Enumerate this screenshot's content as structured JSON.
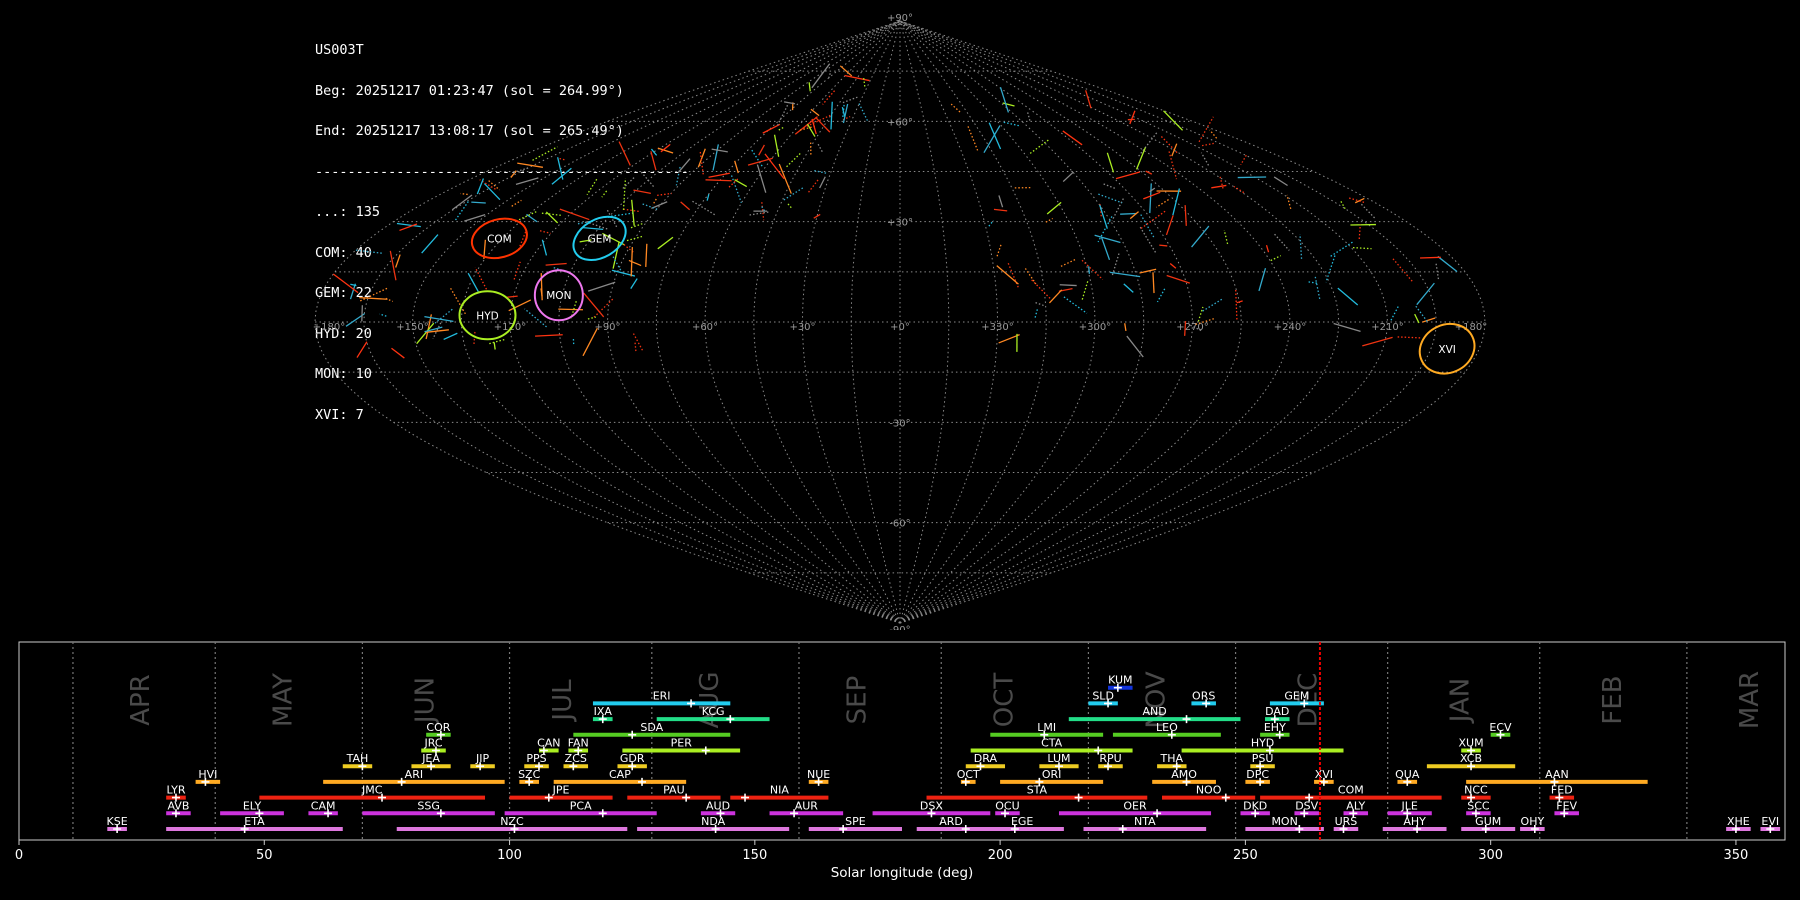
{
  "info": {
    "station": "US003T",
    "begin": "Beg: 20251217 01:23:47 (sol = 264.99°)",
    "end": "End: 20251217 13:08:17 (sol = 265.49°)",
    "separator": "----------------------------------------------",
    "counts": [
      "...: 135",
      "COM: 40",
      "GEM: 22",
      "HYD: 20",
      "MON: 10",
      "XVI: 7"
    ]
  },
  "chart_data": [
    {
      "type": "scatter",
      "projection": "sinusoidal",
      "background": "#000000",
      "grid": true,
      "lon_tick_labels": [
        "+180°",
        "+150°",
        "+120°",
        "+90°",
        "+60°",
        "+30°",
        "+0°",
        "+330°",
        "+300°",
        "+270°",
        "+240°",
        "+210°",
        "+180°"
      ],
      "lon_ticks": [
        180,
        150,
        120,
        90,
        60,
        30,
        0,
        -30,
        -60,
        -90,
        -120,
        -150,
        -180
      ],
      "lat_tick_labels": [
        "+90°",
        "+60°",
        "+30°",
        "-30°",
        "-60°",
        "-90°"
      ],
      "lat_ticks": [
        90,
        60,
        30,
        -30,
        -60,
        -90
      ],
      "radiants": [
        {
          "name": "COM",
          "lon": 136,
          "lat": 25,
          "color": "#ff3300"
        },
        {
          "name": "GEM",
          "lon": 102,
          "lat": 25,
          "color": "#22ccee"
        },
        {
          "name": "MON",
          "lon": 106,
          "lat": 8,
          "color": "#ee77ee"
        },
        {
          "name": "HYD",
          "lon": 127,
          "lat": 2,
          "color": "#aaee22"
        },
        {
          "name": "XVI",
          "lon": -170,
          "lat": -8,
          "color": "#ffaa22"
        }
      ]
    },
    {
      "type": "bar",
      "orientation": "horizontal-timeline",
      "xlabel": "Solar longitude (deg)",
      "xlim": [
        0,
        360
      ],
      "x_ticks": [
        0,
        50,
        100,
        150,
        200,
        250,
        300,
        350
      ],
      "current_sol": 265.2,
      "month_boundaries": [
        11,
        40,
        70,
        100,
        129,
        159,
        188,
        218,
        248,
        279,
        310,
        340
      ],
      "months": [
        {
          "label": "APR",
          "sol": 25
        },
        {
          "label": "MAY",
          "sol": 54
        },
        {
          "label": "JUN",
          "sol": 83
        },
        {
          "label": "JUL",
          "sol": 111
        },
        {
          "label": "AUG",
          "sol": 141
        },
        {
          "label": "SEP",
          "sol": 171
        },
        {
          "label": "OCT",
          "sol": 201
        },
        {
          "label": "NOV",
          "sol": 232
        },
        {
          "label": "DEC",
          "sol": 263
        },
        {
          "label": "JAN",
          "sol": 294
        },
        {
          "label": "FEB",
          "sol": 325
        },
        {
          "label": "MAR",
          "sol": 353
        }
      ],
      "showers": [
        {
          "name": "KUM",
          "start": 222,
          "end": 227,
          "peak": 224,
          "row": 9,
          "color": "#1133dd"
        },
        {
          "name": "ERI",
          "start": 117,
          "end": 145,
          "peak": 137,
          "row": 8,
          "color": "#22ccee"
        },
        {
          "name": "SLD",
          "start": 218,
          "end": 224,
          "peak": 222,
          "row": 8,
          "color": "#22ccee"
        },
        {
          "name": "ORS",
          "start": 239,
          "end": 244,
          "peak": 242,
          "row": 8,
          "color": "#22ccee"
        },
        {
          "name": "GEM",
          "start": 255,
          "end": 266,
          "peak": 262,
          "row": 8,
          "color": "#22ccee"
        },
        {
          "name": "IXA",
          "start": 117,
          "end": 121,
          "peak": 119,
          "row": 7,
          "color": "#22dd88"
        },
        {
          "name": "KCG",
          "start": 130,
          "end": 153,
          "peak": 145,
          "row": 7,
          "color": "#22dd88"
        },
        {
          "name": "AND",
          "start": 214,
          "end": 249,
          "peak": 238,
          "row": 7,
          "color": "#22dd88"
        },
        {
          "name": "DAD",
          "start": 254,
          "end": 259,
          "peak": 256,
          "row": 7,
          "color": "#22dd88"
        },
        {
          "name": "COR",
          "start": 83,
          "end": 88,
          "peak": 86,
          "row": 6,
          "color": "#55cc22"
        },
        {
          "name": "SDA",
          "start": 113,
          "end": 145,
          "peak": 125,
          "row": 6,
          "color": "#55cc22"
        },
        {
          "name": "LMI",
          "start": 198,
          "end": 221,
          "peak": 209,
          "row": 6,
          "color": "#55cc22"
        },
        {
          "name": "LEO",
          "start": 223,
          "end": 245,
          "peak": 235,
          "row": 6,
          "color": "#55cc22"
        },
        {
          "name": "EHY",
          "start": 253,
          "end": 259,
          "peak": 257,
          "row": 6,
          "color": "#55cc22"
        },
        {
          "name": "ECV",
          "start": 300,
          "end": 304,
          "peak": 302,
          "row": 6,
          "color": "#55cc22"
        },
        {
          "name": "JRC",
          "start": 82,
          "end": 87,
          "peak": 85,
          "row": 5,
          "color": "#aaee22"
        },
        {
          "name": "CAN",
          "start": 106,
          "end": 110,
          "peak": 107,
          "row": 5,
          "color": "#aaee22"
        },
        {
          "name": "FAN",
          "start": 112,
          "end": 116,
          "peak": 114,
          "row": 5,
          "color": "#aaee22"
        },
        {
          "name": "PER",
          "start": 123,
          "end": 147,
          "peak": 140,
          "row": 5,
          "color": "#aaee22"
        },
        {
          "name": "CTA",
          "start": 194,
          "end": 227,
          "peak": 220,
          "row": 5,
          "color": "#aaee22"
        },
        {
          "name": "HYD",
          "start": 237,
          "end": 270,
          "peak": 255,
          "row": 5,
          "color": "#aaee22"
        },
        {
          "name": "XUM",
          "start": 294,
          "end": 298,
          "peak": 296,
          "row": 5,
          "color": "#aaee22"
        },
        {
          "name": "TAH",
          "start": 66,
          "end": 72,
          "peak": 70,
          "row": 4,
          "color": "#eecc22"
        },
        {
          "name": "JEA",
          "start": 80,
          "end": 88,
          "peak": 84,
          "row": 4,
          "color": "#eecc22"
        },
        {
          "name": "JIP",
          "start": 92,
          "end": 97,
          "peak": 94,
          "row": 4,
          "color": "#eecc22"
        },
        {
          "name": "PPS",
          "start": 103,
          "end": 108,
          "peak": 106,
          "row": 4,
          "color": "#eecc22"
        },
        {
          "name": "ZCS",
          "start": 111,
          "end": 116,
          "peak": 113,
          "row": 4,
          "color": "#eecc22"
        },
        {
          "name": "GDR",
          "start": 122,
          "end": 128,
          "peak": 125,
          "row": 4,
          "color": "#eecc22"
        },
        {
          "name": "DRA",
          "start": 193,
          "end": 201,
          "peak": 196,
          "row": 4,
          "color": "#eecc22"
        },
        {
          "name": "LUM",
          "start": 208,
          "end": 216,
          "peak": 212,
          "row": 4,
          "color": "#eecc22"
        },
        {
          "name": "RPU",
          "start": 220,
          "end": 225,
          "peak": 222,
          "row": 4,
          "color": "#eecc22"
        },
        {
          "name": "THA",
          "start": 232,
          "end": 238,
          "peak": 236,
          "row": 4,
          "color": "#eecc22"
        },
        {
          "name": "PSU",
          "start": 251,
          "end": 256,
          "peak": 253,
          "row": 4,
          "color": "#eecc22"
        },
        {
          "name": "XCB",
          "start": 287,
          "end": 305,
          "peak": 296,
          "row": 4,
          "color": "#eecc22"
        },
        {
          "name": "HVI",
          "start": 36,
          "end": 41,
          "peak": 38,
          "row": 3,
          "color": "#ffaa22"
        },
        {
          "name": "ARI",
          "start": 62,
          "end": 99,
          "peak": 78,
          "row": 3,
          "color": "#ffaa22"
        },
        {
          "name": "SZC",
          "start": 102,
          "end": 106,
          "peak": 104,
          "row": 3,
          "color": "#ffaa22"
        },
        {
          "name": "CAP",
          "start": 109,
          "end": 136,
          "peak": 127,
          "row": 3,
          "color": "#ffaa22"
        },
        {
          "name": "NUE",
          "start": 161,
          "end": 165,
          "peak": 163,
          "row": 3,
          "color": "#ffaa22"
        },
        {
          "name": "OCT",
          "start": 192,
          "end": 195,
          "peak": 193,
          "row": 3,
          "color": "#ffaa22"
        },
        {
          "name": "ORI",
          "start": 200,
          "end": 221,
          "peak": 208,
          "row": 3,
          "color": "#ffaa22"
        },
        {
          "name": "AMO",
          "start": 231,
          "end": 244,
          "peak": 238,
          "row": 3,
          "color": "#ffaa22"
        },
        {
          "name": "DPC",
          "start": 250,
          "end": 255,
          "peak": 253,
          "row": 3,
          "color": "#ffaa22"
        },
        {
          "name": "XVI",
          "start": 264,
          "end": 268,
          "peak": 266,
          "row": 3,
          "color": "#ffaa22"
        },
        {
          "name": "QUA",
          "start": 281,
          "end": 285,
          "peak": 283,
          "row": 3,
          "color": "#ffaa22"
        },
        {
          "name": "AAN",
          "start": 295,
          "end": 332,
          "peak": 313,
          "row": 3,
          "color": "#ffaa22"
        },
        {
          "name": "LYR",
          "start": 30,
          "end": 34,
          "peak": 32,
          "row": 2,
          "color": "#ee2211"
        },
        {
          "name": "JMC",
          "start": 49,
          "end": 95,
          "peak": 74,
          "row": 2,
          "color": "#ee2211"
        },
        {
          "name": "JPE",
          "start": 100,
          "end": 121,
          "peak": 108,
          "row": 2,
          "color": "#ee2211"
        },
        {
          "name": "PAU",
          "start": 124,
          "end": 143,
          "peak": 136,
          "row": 2,
          "color": "#ee2211"
        },
        {
          "name": "NIA",
          "start": 145,
          "end": 165,
          "peak": 148,
          "row": 2,
          "color": "#ee2211"
        },
        {
          "name": "STA",
          "start": 185,
          "end": 230,
          "peak": 216,
          "row": 2,
          "color": "#ee2211"
        },
        {
          "name": "NOO",
          "start": 233,
          "end": 252,
          "peak": 246,
          "row": 2,
          "color": "#ee2211"
        },
        {
          "name": "COM",
          "start": 253,
          "end": 290,
          "peak": 263,
          "row": 2,
          "color": "#ee2211"
        },
        {
          "name": "NCC",
          "start": 294,
          "end": 300,
          "peak": 296,
          "row": 2,
          "color": "#ee2211"
        },
        {
          "name": "FED",
          "start": 312,
          "end": 317,
          "peak": 314,
          "row": 2,
          "color": "#ee2211"
        },
        {
          "name": "AVB",
          "start": 30,
          "end": 35,
          "peak": 32,
          "row": 1,
          "color": "#cc33dd"
        },
        {
          "name": "ELY",
          "start": 41,
          "end": 54,
          "peak": 49,
          "row": 1,
          "color": "#cc33dd"
        },
        {
          "name": "CAM",
          "start": 59,
          "end": 65,
          "peak": 63,
          "row": 1,
          "color": "#cc33dd"
        },
        {
          "name": "SSG",
          "start": 70,
          "end": 97,
          "peak": 86,
          "row": 1,
          "color": "#cc33dd"
        },
        {
          "name": "PCA",
          "start": 99,
          "end": 130,
          "peak": 119,
          "row": 1,
          "color": "#cc33dd"
        },
        {
          "name": "AUD",
          "start": 139,
          "end": 146,
          "peak": 143,
          "row": 1,
          "color": "#cc33dd"
        },
        {
          "name": "AUR",
          "start": 153,
          "end": 168,
          "peak": 158,
          "row": 1,
          "color": "#cc33dd"
        },
        {
          "name": "DSX",
          "start": 174,
          "end": 198,
          "peak": 186,
          "row": 1,
          "color": "#cc33dd"
        },
        {
          "name": "OCU",
          "start": 199,
          "end": 204,
          "peak": 201,
          "row": 1,
          "color": "#cc33dd"
        },
        {
          "name": "OER",
          "start": 212,
          "end": 243,
          "peak": 232,
          "row": 1,
          "color": "#cc33dd"
        },
        {
          "name": "DKD",
          "start": 249,
          "end": 255,
          "peak": 252,
          "row": 1,
          "color": "#cc33dd"
        },
        {
          "name": "DSV",
          "start": 260,
          "end": 265,
          "peak": 262,
          "row": 1,
          "color": "#cc33dd"
        },
        {
          "name": "ALY",
          "start": 270,
          "end": 275,
          "peak": 272,
          "row": 1,
          "color": "#cc33dd"
        },
        {
          "name": "JLE",
          "start": 279,
          "end": 288,
          "peak": 283,
          "row": 1,
          "color": "#cc33dd"
        },
        {
          "name": "SCC",
          "start": 295,
          "end": 300,
          "peak": 297,
          "row": 1,
          "color": "#cc33dd"
        },
        {
          "name": "FEV",
          "start": 313,
          "end": 318,
          "peak": 315,
          "row": 1,
          "color": "#cc33dd"
        },
        {
          "name": "KSE",
          "start": 18,
          "end": 22,
          "peak": 20,
          "row": 0,
          "color": "#dd77dd"
        },
        {
          "name": "ETA",
          "start": 30,
          "end": 66,
          "peak": 46,
          "row": 0,
          "color": "#dd77dd"
        },
        {
          "name": "NZC",
          "start": 77,
          "end": 124,
          "peak": 101,
          "row": 0,
          "color": "#dd77dd"
        },
        {
          "name": "NDA",
          "start": 126,
          "end": 157,
          "peak": 142,
          "row": 0,
          "color": "#dd77dd"
        },
        {
          "name": "SPE",
          "start": 161,
          "end": 180,
          "peak": 168,
          "row": 0,
          "color": "#dd77dd"
        },
        {
          "name": "ARD",
          "start": 183,
          "end": 197,
          "peak": 193,
          "row": 0,
          "color": "#dd77dd"
        },
        {
          "name": "EGE",
          "start": 196,
          "end": 213,
          "peak": 203,
          "row": 0,
          "color": "#dd77dd"
        },
        {
          "name": "NTA",
          "start": 217,
          "end": 242,
          "peak": 225,
          "row": 0,
          "color": "#dd77dd"
        },
        {
          "name": "MON",
          "start": 250,
          "end": 266,
          "peak": 261,
          "row": 0,
          "color": "#dd77dd"
        },
        {
          "name": "URS",
          "start": 268,
          "end": 273,
          "peak": 270,
          "row": 0,
          "color": "#dd77dd"
        },
        {
          "name": "AHY",
          "start": 278,
          "end": 291,
          "peak": 285,
          "row": 0,
          "color": "#dd77dd"
        },
        {
          "name": "GUM",
          "start": 294,
          "end": 305,
          "peak": 299,
          "row": 0,
          "color": "#dd77dd"
        },
        {
          "name": "OHY",
          "start": 306,
          "end": 311,
          "peak": 309,
          "row": 0,
          "color": "#dd77dd"
        },
        {
          "name": "XHE",
          "start": 348,
          "end": 353,
          "peak": 350,
          "row": 0,
          "color": "#dd77dd"
        },
        {
          "name": "EVI",
          "start": 355,
          "end": 359,
          "peak": 357,
          "row": 0,
          "color": "#dd77dd"
        }
      ]
    }
  ]
}
